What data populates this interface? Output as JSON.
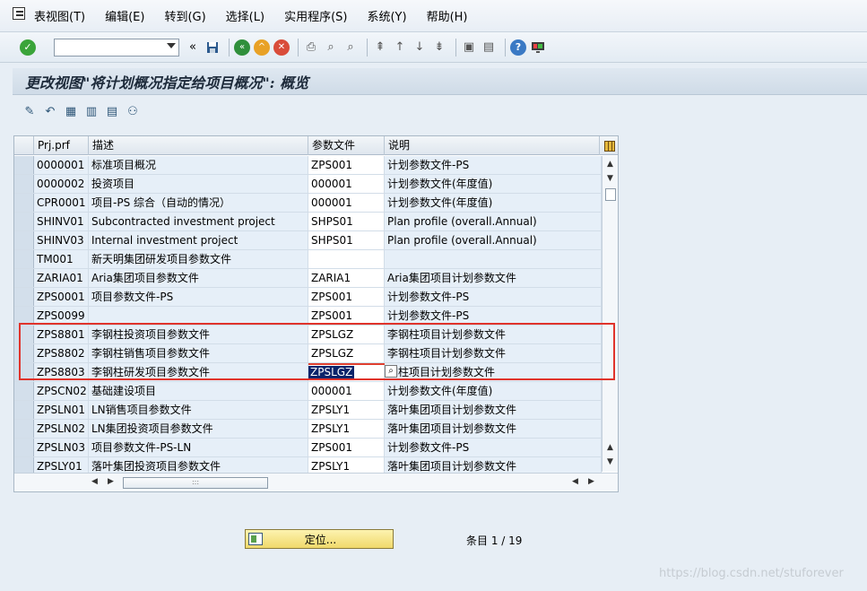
{
  "menu": {
    "items": [
      {
        "label": "表视图(T)"
      },
      {
        "label": "编辑(E)"
      },
      {
        "label": "转到(G)"
      },
      {
        "label": "选择(L)"
      },
      {
        "label": "实用程序(S)"
      },
      {
        "label": "系统(Y)"
      },
      {
        "label": "帮助(H)"
      }
    ]
  },
  "toolbar": {
    "command_value": "",
    "back_glyph": "«"
  },
  "title": "更改视图\"将计划概况指定给项目概况\": 概览",
  "table": {
    "headers": {
      "c1": "Prj.prf",
      "c2": "描述",
      "c3": "参数文件",
      "c4": "说明"
    },
    "rows": [
      {
        "c1": "0000001",
        "c2": "标准项目概况",
        "c3": "ZPS001",
        "c4": "计划参数文件-PS"
      },
      {
        "c1": "0000002",
        "c2": "投资项目",
        "c3": "000001",
        "c4": "计划参数文件(年度值)"
      },
      {
        "c1": "CPR0001",
        "c2": "项目-PS 综合（自动的情况）",
        "c3": "000001",
        "c4": "计划参数文件(年度值)"
      },
      {
        "c1": "SHINV01",
        "c2": "Subcontracted investment project",
        "c3": "SHPS01",
        "c4": "Plan profile (overall.Annual)"
      },
      {
        "c1": "SHINV03",
        "c2": "Internal investment project",
        "c3": "SHPS01",
        "c4": "Plan profile (overall.Annual)"
      },
      {
        "c1": "TM001",
        "c2": "新天明集团研发项目参数文件",
        "c3": "",
        "c4": ""
      },
      {
        "c1": "ZARIA01",
        "c2": "Aria集团项目参数文件",
        "c3": "ZARIA1",
        "c4": "Aria集团项目计划参数文件"
      },
      {
        "c1": "ZPS0001",
        "c2": "项目参数文件-PS",
        "c3": "ZPS001",
        "c4": "计划参数文件-PS"
      },
      {
        "c1": "ZPS0099",
        "c2": "",
        "c3": "ZPS001",
        "c4": "计划参数文件-PS"
      },
      {
        "c1": "ZPS8801",
        "c2": "李钢柱投资项目参数文件",
        "c3": "ZPSLGZ",
        "c4": "李钢柱项目计划参数文件"
      },
      {
        "c1": "ZPS8802",
        "c2": "李钢柱销售项目参数文件",
        "c3": "ZPSLGZ",
        "c4": "李钢柱项目计划参数文件"
      },
      {
        "c1": "ZPS8803",
        "c2": "李钢柱研发项目参数文件",
        "c3": "ZPSLGZ",
        "c4": "钢柱项目计划参数文件"
      },
      {
        "c1": "ZPSCN02",
        "c2": "基础建设项目",
        "c3": "000001",
        "c4": "计划参数文件(年度值)"
      },
      {
        "c1": "ZPSLN01",
        "c2": "LN销售项目参数文件",
        "c3": "ZPSLY1",
        "c4": "落叶集团项目计划参数文件"
      },
      {
        "c1": "ZPSLN02",
        "c2": "LN集团投资项目参数文件",
        "c3": "ZPSLY1",
        "c4": "落叶集团项目计划参数文件"
      },
      {
        "c1": "ZPSLN03",
        "c2": "项目参数文件-PS-LN",
        "c3": "ZPS001",
        "c4": "计划参数文件-PS"
      },
      {
        "c1": "ZPSLY01",
        "c2": "落叶集团投资项目参数文件",
        "c3": "ZPSLY1",
        "c4": "落叶集团项目计划参数文件"
      }
    ]
  },
  "position_button": "定位...",
  "entry_counter": "条目 1 / 19",
  "watermark": "https://blog.csdn.net/stuforever",
  "colors": {
    "highlight": "#e0332b",
    "selected_text_bg": "#0a246a"
  }
}
